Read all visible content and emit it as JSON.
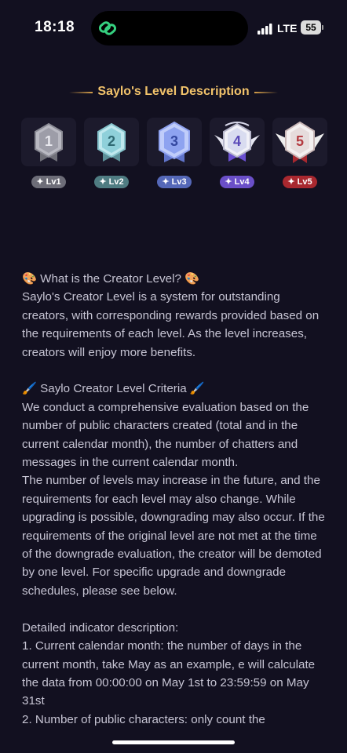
{
  "status_bar": {
    "time": "18:18",
    "network": "LTE",
    "battery": "55"
  },
  "page": {
    "title": "Saylo's Level Description"
  },
  "levels": [
    {
      "number": "1",
      "label": "✦ Lv1",
      "color": "#8c8c96"
    },
    {
      "number": "2",
      "label": "✦ Lv2",
      "color": "#7fb6c0"
    },
    {
      "number": "3",
      "label": "✦ Lv3",
      "color": "#7f95e6"
    },
    {
      "number": "4",
      "label": "✦ Lv4",
      "color": "#8b6be8"
    },
    {
      "number": "5",
      "label": "✦ Lv5",
      "color": "#c5454b"
    }
  ],
  "sections": {
    "creator_level": {
      "heading": "🎨 What is the Creator Level? 🎨",
      "body": "Saylo's Creator Level is a system for outstanding creators, with corresponding rewards provided based on the requirements of each level. As the level increases, creators will enjoy more benefits."
    },
    "criteria": {
      "heading": "🖌️ Saylo Creator Level Criteria 🖌️",
      "body1": "We conduct a comprehensive evaluation based on the number of public characters created (total and in the current calendar month), the number of chatters and messages in the current calendar month.",
      "body2": "The number of levels may increase in the future, and the requirements for each level may also change. While upgrading is possible, downgrading may also occur. If the requirements of the original level are not met at the time of the downgrade evaluation, the creator will be demoted by one level. For specific upgrade and downgrade schedules, please see below."
    },
    "indicators": {
      "heading": "Detailed indicator description:",
      "item1": "1. Current calendar month: the number of days in the current month, take May as an example, e will calculate the data from 00:00:00 on May 1st to 23:59:59 on May 31st",
      "item2": "2. Number of public characters: only count the"
    }
  }
}
